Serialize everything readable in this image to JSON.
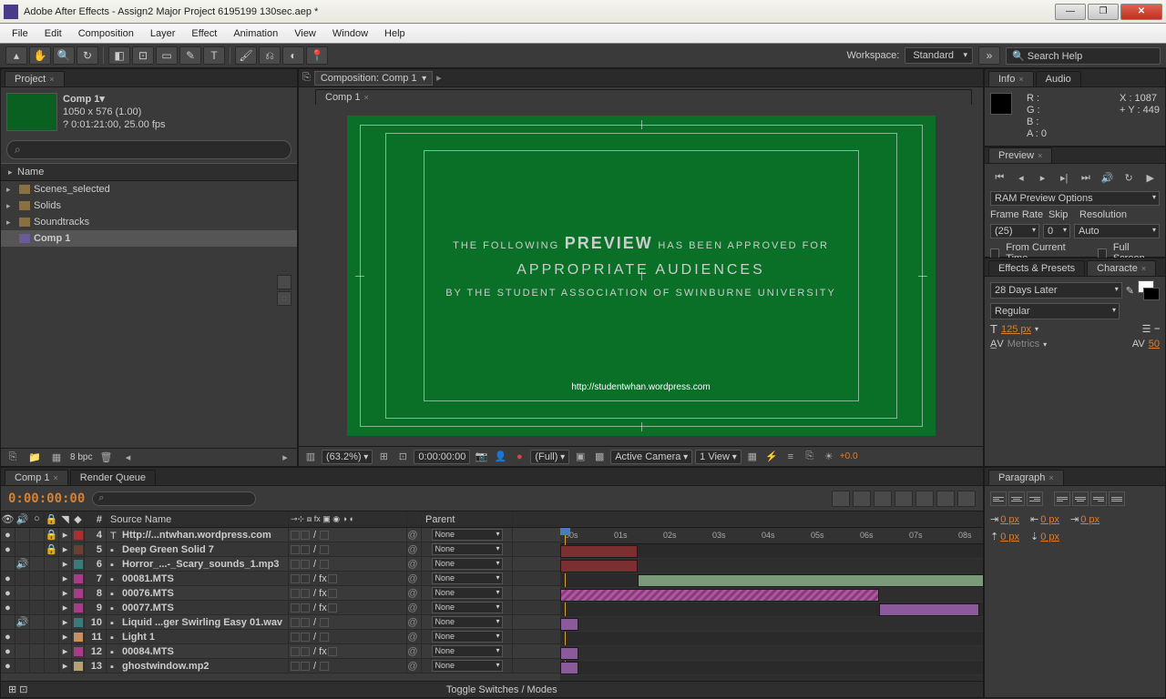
{
  "window": {
    "title": "Adobe After Effects - Assign2 Major Project 6195199 130sec.aep *"
  },
  "menu": [
    "File",
    "Edit",
    "Composition",
    "Layer",
    "Effect",
    "Animation",
    "View",
    "Window",
    "Help"
  ],
  "workspace": {
    "label": "Workspace:",
    "value": "Standard",
    "search_placeholder": "Search Help"
  },
  "project": {
    "tab": "Project",
    "comp_name": "Comp 1▾",
    "dims": "1050 x 576 (1.00)",
    "dur": "? 0:01:21:00, 25.00 fps",
    "name_header": "Name",
    "items": [
      {
        "name": "Scenes_selected",
        "type": "folder"
      },
      {
        "name": "Solids",
        "type": "folder"
      },
      {
        "name": "Soundtracks",
        "type": "folder"
      },
      {
        "name": "Comp 1",
        "type": "comp",
        "selected": true
      }
    ],
    "footer_bpc": "8 bpc"
  },
  "composition": {
    "header_label": "Composition: Comp 1",
    "tab": "Comp 1",
    "rating": {
      "l1a": "THE FOLLOWING",
      "l1b": "PREVIEW",
      "l1c": "HAS BEEN APPROVED FOR",
      "l2": "APPROPRIATE AUDIENCES",
      "l3": "BY THE STUDENT ASSOCIATION OF SWINBURNE UNIVERSITY",
      "url": "http://studentwhan.wordpress.com"
    },
    "footer": {
      "zoom": "(63.2%)",
      "time": "0:00:00:00",
      "quality": "(Full)",
      "camera": "Active Camera",
      "views": "1 View",
      "exposure": "+0.0"
    }
  },
  "info": {
    "tab1": "Info",
    "tab2": "Audio",
    "R": "R :",
    "G": "G :",
    "B": "B :",
    "A": "A :  0",
    "X": "X : 1087",
    "Y": "Y : 449"
  },
  "preview": {
    "tab": "Preview",
    "ram_label": "RAM Preview Options",
    "frame_rate_label": "Frame Rate",
    "frame_rate": "(25)",
    "skip_label": "Skip",
    "skip": "0",
    "res_label": "Resolution",
    "res": "Auto",
    "from_current": "From Current Time",
    "full_screen": "Full Screen"
  },
  "effects": {
    "tab1": "Effects & Presets",
    "tab2": "Characte"
  },
  "character": {
    "font": "28 Days Later",
    "style": "Regular",
    "size": "125 px",
    "kerning": "Metrics",
    "tracking": "50",
    "size_icon": "T",
    "lead_icon": "A",
    "av_icon": "AV"
  },
  "paragraph": {
    "tab": "Paragraph",
    "indents": [
      "0 px",
      "0 px",
      "0 px",
      "0 px",
      "0 px"
    ]
  },
  "timeline": {
    "tab1": "Comp 1",
    "tab2": "Render Queue",
    "timecode": "0:00:00:00",
    "col_source": "Source Name",
    "col_parent": "Parent",
    "col_num": "#",
    "parent_none": "None",
    "footer": "Toggle Switches / Modes",
    "ruler": [
      "00s",
      "01s",
      "02s",
      "03s",
      "04s",
      "05s",
      "06s",
      "07s",
      "08s"
    ],
    "layers": [
      {
        "n": 4,
        "name": "Http://...ntwhan.wordpress.com",
        "lbl": "lbl-red",
        "eye": true,
        "lock": true,
        "type": "T"
      },
      {
        "n": 5,
        "name": "Deep Green Solid 7",
        "lbl": "lbl-brown",
        "eye": true,
        "lock": true
      },
      {
        "n": 6,
        "name": "Horror_...-_Scary_sounds_1.mp3",
        "lbl": "lbl-teal",
        "aud": true
      },
      {
        "n": 7,
        "name": "00081.MTS",
        "lbl": "lbl-pink",
        "eye": true,
        "fx": true
      },
      {
        "n": 8,
        "name": "00076.MTS",
        "lbl": "lbl-pink",
        "eye": true,
        "fx": true
      },
      {
        "n": 9,
        "name": "00077.MTS",
        "lbl": "lbl-pink",
        "eye": true,
        "fx": true
      },
      {
        "n": 10,
        "name": "Liquid ...ger Swirling Easy 01.wav",
        "lbl": "lbl-teal",
        "aud": true
      },
      {
        "n": 11,
        "name": "Light 1",
        "lbl": "lbl-peach",
        "eye": true
      },
      {
        "n": 12,
        "name": "00084.MTS",
        "lbl": "lbl-pink",
        "eye": true,
        "fx": true
      },
      {
        "n": 13,
        "name": "ghostwindow.mp2",
        "lbl": "lbl-tan",
        "eye": true
      }
    ]
  }
}
